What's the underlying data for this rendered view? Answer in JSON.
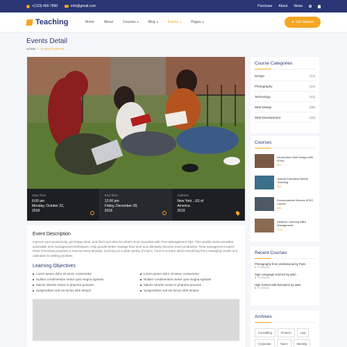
{
  "topbar": {
    "phone": "+(123) 456-7890",
    "email": "info@gmail.com",
    "links": [
      "Purchase",
      "About",
      "News"
    ]
  },
  "header": {
    "logo": "Teaching",
    "nav": [
      {
        "label": "Home",
        "dropdown": false,
        "active": false
      },
      {
        "label": "About",
        "dropdown": false,
        "active": false
      },
      {
        "label": "Courses",
        "dropdown": true,
        "active": false
      },
      {
        "label": "Blog",
        "dropdown": true,
        "active": false
      },
      {
        "label": "Events",
        "dropdown": true,
        "active": true
      },
      {
        "label": "Pages",
        "dropdown": true,
        "active": false
      }
    ],
    "cta": "Get Started"
  },
  "page": {
    "title": "Events Detail",
    "breadcrumb": [
      "HOME",
      "/",
      "EVENTS DETAIL"
    ]
  },
  "event_info": [
    {
      "label": "Start Time",
      "value": "6:00 am",
      "value2": "Monday, October 22,",
      "value3": "2018"
    },
    {
      "label": "End Time",
      "value": "12:00 pm",
      "value2": "Friday, December 28,",
      "value3": "2018"
    },
    {
      "label": "Address",
      "value": "New York , US of",
      "value2": "America",
      "value3": "2019"
    }
  ],
  "description": {
    "title": "Event Description",
    "text": "Improve your productivity, get things done, and find more time for what's most important with Time Management Tips. This weekly series provides actionable time management techniques. Help people better manage their time and ultimately become more productive. Time management expert Dave Crenshaw preaches a new tip every Monday, touching on a wide variety of topics. Tune in to learn about everything from managing emails and calendars to setting priorities.",
    "objectives_title": "Learning Objectives",
    "objectives_left": [
      "Lorem ipsum dolor sit amet, consectetur",
      "Nullam condimentum metus quis magna egestas",
      "Mauris lobortis metus in pharetra posuere",
      "Suspendisse sed est luctus nibh tempor"
    ],
    "objectives_right": [
      "Lorem ipsum dolor sit amet, consectetur",
      "Nullam condimentum metus quis magna egestas",
      "Mauris lobortis metus in pharetra posuere",
      "Suspendisse sed est luctus nibh tempor"
    ]
  },
  "sidebar": {
    "categories_title": "Course Categories",
    "categories": [
      {
        "name": "Design",
        "count": "(12)"
      },
      {
        "name": "Photography",
        "count": "(10)"
      },
      {
        "name": "Technology",
        "count": "(13)"
      },
      {
        "name": "Web Design",
        "count": "(09)"
      },
      {
        "name": "Web Development",
        "count": "(16)"
      }
    ],
    "courses_title": "Courses",
    "courses": [
      {
        "title": "Introduction Web Design with HTML",
        "price": "$20",
        "thumb": "#7a5a44"
      },
      {
        "title": "Special Education Needs Teaching",
        "price": "$20",
        "thumb": "#3b6f8a"
      },
      {
        "title": "Environmental Science BTEC Course",
        "price": "$20",
        "thumb": "#4d5a66"
      },
      {
        "title": "Distance Learning MBA Management",
        "price": "Free",
        "thumb": "#8a6a52"
      }
    ],
    "recent_title": "Recent Courses",
    "recent": [
      {
        "title": "Photography from professional by Paris",
        "meta": "3 Lessons"
      },
      {
        "title": "Sign Language Science by asiin",
        "meta": "4 Lessons"
      },
      {
        "title": "High School with Education by asiin",
        "meta": "5 Lessons"
      }
    ],
    "archives_title": "Archives",
    "tags": [
      "Consulting",
      "Finance",
      "Law",
      "Corporate",
      "Taxes",
      "Meeting"
    ]
  },
  "colors": {
    "navy": "#2b3574",
    "accent": "#f5a623"
  }
}
